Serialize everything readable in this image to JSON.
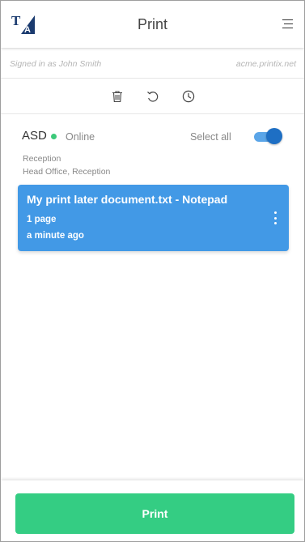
{
  "header": {
    "title": "Print",
    "logo_letters": [
      "T",
      "A"
    ],
    "logo_icon": "ta-logo-icon",
    "menu_icon": "hamburger-menu-icon"
  },
  "session": {
    "signed_in_text": "Signed in as John Smith",
    "domain": "acme.printix.net"
  },
  "toolbar": {
    "icons": [
      "trash-icon",
      "refresh-icon",
      "clock-icon"
    ]
  },
  "printer": {
    "name": "ASD",
    "status": "Online",
    "status_color": "#3cc97a",
    "select_all_label": "Select all",
    "select_all_on": true,
    "location_line1": "Reception",
    "location_line2": "Head Office, Reception"
  },
  "jobs": [
    {
      "title": "My print later document.txt - Notepad",
      "pages": "1 page",
      "time": "a minute ago",
      "menu_icon": "more-vertical-icon"
    }
  ],
  "footer": {
    "print_label": "Print"
  },
  "colors": {
    "accent_blue": "#4299e6",
    "toggle_knob": "#1e6fc4",
    "print_green": "#34cd83",
    "logo_navy": "#1b3b6f"
  }
}
